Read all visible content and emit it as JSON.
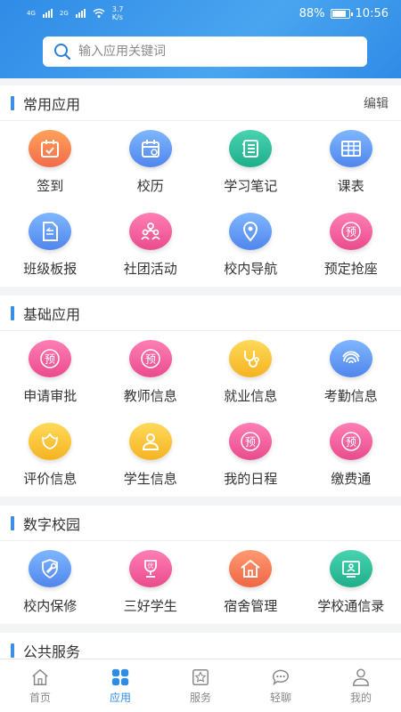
{
  "status": {
    "net_label_1": "4G",
    "net_label_2": "2G",
    "speed_top": "3.7",
    "speed_bottom": "K/s",
    "battery": "88%",
    "time": "10:56"
  },
  "search": {
    "placeholder": "输入应用关键词"
  },
  "sections": {
    "common": {
      "title": "常用应用",
      "action": "编辑",
      "items": [
        {
          "label": "签到",
          "icon": "calendar-check-icon",
          "color": "orange"
        },
        {
          "label": "校历",
          "icon": "calendar-icon",
          "color": "blue"
        },
        {
          "label": "学习笔记",
          "icon": "notebook-icon",
          "color": "teal"
        },
        {
          "label": "课表",
          "icon": "table-icon",
          "color": "blue"
        },
        {
          "label": "班级板报",
          "icon": "document-icon",
          "color": "blue"
        },
        {
          "label": "社团活动",
          "icon": "people-icon",
          "color": "pink"
        },
        {
          "label": "校内导航",
          "icon": "location-pin-icon",
          "color": "blue"
        },
        {
          "label": "预定抢座",
          "icon": "reserve-icon",
          "color": "pink"
        }
      ]
    },
    "basic": {
      "title": "基础应用",
      "items": [
        {
          "label": "申请审批",
          "icon": "reserve-icon",
          "color": "pink"
        },
        {
          "label": "教师信息",
          "icon": "reserve-icon",
          "color": "pink"
        },
        {
          "label": "就业信息",
          "icon": "stethoscope-icon",
          "color": "yellow"
        },
        {
          "label": "考勤信息",
          "icon": "fingerprint-icon",
          "color": "blue"
        },
        {
          "label": "评价信息",
          "icon": "flower-icon",
          "color": "yellow"
        },
        {
          "label": "学生信息",
          "icon": "person-icon",
          "color": "yellow"
        },
        {
          "label": "我的日程",
          "icon": "reserve-icon",
          "color": "pink"
        },
        {
          "label": "缴费通",
          "icon": "reserve-icon",
          "color": "pink"
        }
      ]
    },
    "campus": {
      "title": "数字校园",
      "items": [
        {
          "label": "校内保修",
          "icon": "wrench-icon",
          "color": "blue"
        },
        {
          "label": "三好学生",
          "icon": "trophy-icon",
          "color": "pink"
        },
        {
          "label": "宿舍管理",
          "icon": "house-icon",
          "color": "red"
        },
        {
          "label": "学校通信录",
          "icon": "contacts-icon",
          "color": "teal"
        }
      ]
    },
    "public": {
      "title": "公共服务"
    }
  },
  "reserve_glyph": "预",
  "trophy_glyph": "优",
  "tabs": [
    {
      "label": "首页",
      "icon": "home-icon",
      "active": false
    },
    {
      "label": "应用",
      "icon": "apps-icon",
      "active": true
    },
    {
      "label": "服务",
      "icon": "star-frame-icon",
      "active": false
    },
    {
      "label": "轻聊",
      "icon": "chat-icon",
      "active": false
    },
    {
      "label": "我的",
      "icon": "profile-icon",
      "active": false
    }
  ]
}
